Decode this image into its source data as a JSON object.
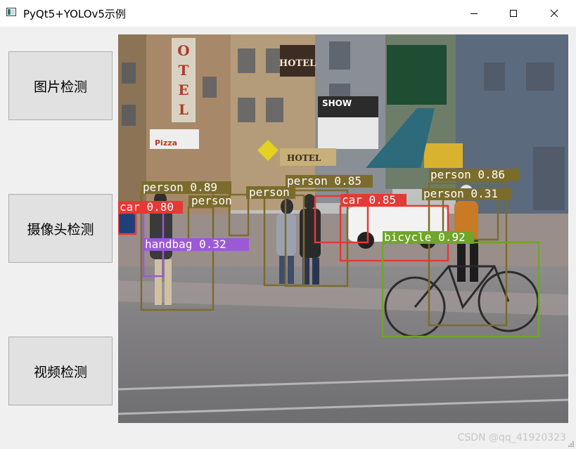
{
  "window": {
    "title": "PyQt5+YOLOv5示例",
    "icon": "app-window-icon",
    "controls": [
      "minimize-icon",
      "maximize-icon",
      "close-icon"
    ]
  },
  "sidebar": {
    "buttons": [
      {
        "label": "图片检测"
      },
      {
        "label": "摄像头检测"
      },
      {
        "label": "视频检测"
      }
    ]
  },
  "detections": [
    {
      "label": "person 0.89",
      "color": "#7b6c2e"
    },
    {
      "label": "person",
      "color": "#7b6c2e"
    },
    {
      "label": "person",
      "color": "#7b6c2e"
    },
    {
      "label": "person 0.85",
      "color": "#7b6c2e"
    },
    {
      "label": "person 0.86",
      "color": "#7b6c2e"
    },
    {
      "label": "person 0.31",
      "color": "#7b6c2e"
    },
    {
      "label": "car 0.80",
      "color": "#e53935"
    },
    {
      "label": "car 0.85",
      "color": "#e53935"
    },
    {
      "label": "handbag 0.32",
      "color": "#9b59d6"
    },
    {
      "label": "bicycle 0.92",
      "color": "#6fa52a"
    }
  ],
  "scene_signs": [
    "HOTEL",
    "HOTEL",
    "SHOW",
    "Pizza",
    "HOTEL"
  ],
  "watermark": "CSDN @qq_41920323"
}
